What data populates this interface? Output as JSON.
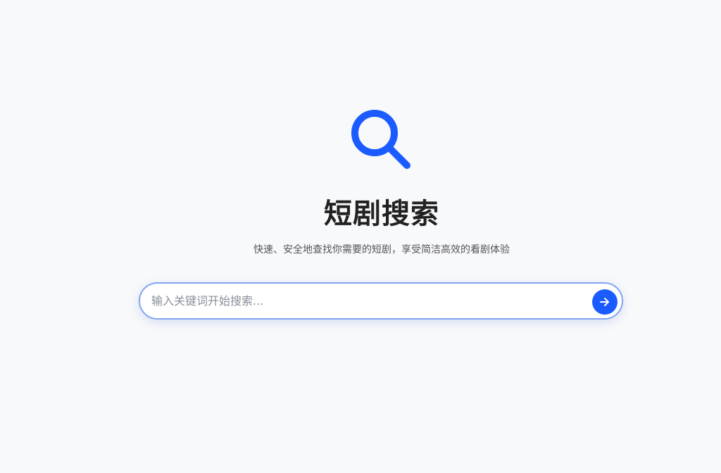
{
  "header": {
    "logo_icon": "search-icon",
    "title": "短剧搜索",
    "subtitle": "快速、安全地查找你需要的短剧，享受简洁高效的看剧体验"
  },
  "search": {
    "placeholder": "输入关键词开始搜索...",
    "value": "",
    "submit_icon": "arrow-right-icon"
  },
  "colors": {
    "accent": "#1a5cff",
    "background": "#f8f9fb",
    "title": "#222222"
  }
}
